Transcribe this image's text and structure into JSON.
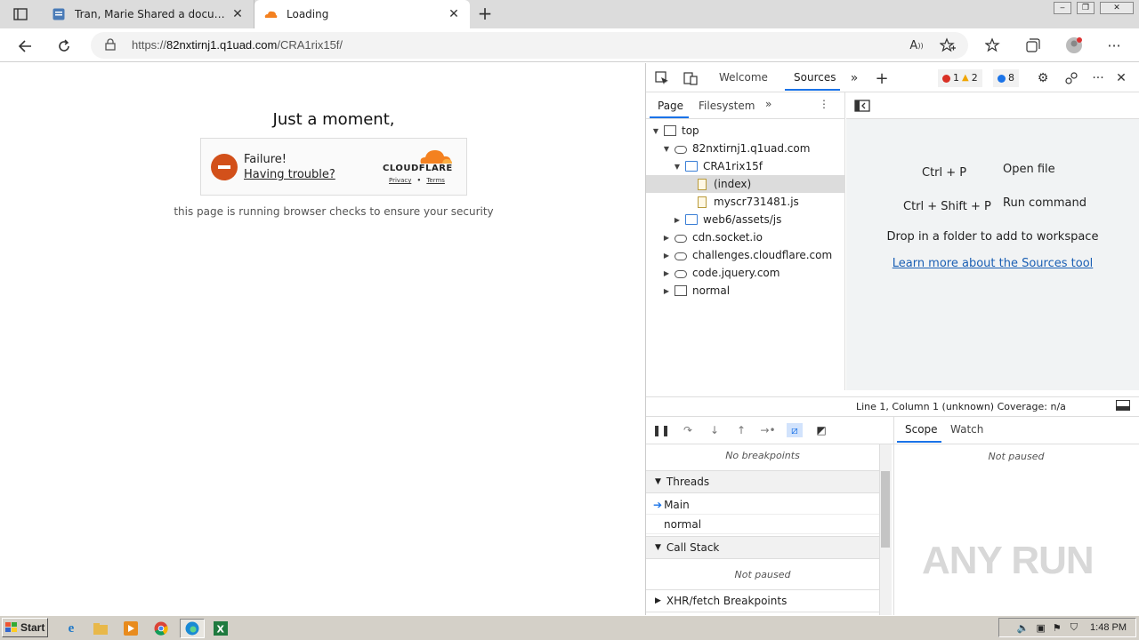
{
  "browser": {
    "tabs": [
      {
        "title": "Tran, Marie Shared a document w",
        "active": false
      },
      {
        "title": "Loading",
        "active": true
      }
    ],
    "address": {
      "scheme": "https://",
      "host": "82nxtirnj1.q1uad.com",
      "path": "/CRA1rix15f/"
    }
  },
  "page": {
    "heading": "Just a moment,",
    "challenge": {
      "status": "Failure!",
      "help_link": "Having trouble?",
      "brand": "CLOUDFLARE",
      "privacy": "Privacy",
      "separator": "•",
      "terms": "Terms"
    },
    "subtext": "this page is running browser checks to ensure your security"
  },
  "devtools": {
    "tabs": [
      "Welcome",
      "Sources"
    ],
    "active_tab": "Sources",
    "badges": {
      "errors": "1",
      "warnings": "2",
      "info": "8"
    },
    "navigator_tabs": [
      "Page",
      "Filesystem"
    ],
    "tree": [
      {
        "label": "top",
        "type": "frame",
        "depth": 0,
        "expanded": true
      },
      {
        "label": "82nxtirnj1.q1uad.com",
        "type": "cloud",
        "depth": 1,
        "expanded": true
      },
      {
        "label": "CRA1rix15f",
        "type": "folder",
        "depth": 2,
        "expanded": true
      },
      {
        "label": "(index)",
        "type": "file",
        "depth": 3,
        "selected": true
      },
      {
        "label": "myscr731481.js",
        "type": "file",
        "depth": 3
      },
      {
        "label": "web6/assets/js",
        "type": "folder",
        "depth": 2,
        "expanded": false
      },
      {
        "label": "cdn.socket.io",
        "type": "cloud",
        "depth": 1,
        "expanded": false
      },
      {
        "label": "challenges.cloudflare.com",
        "type": "cloud",
        "depth": 1,
        "expanded": false
      },
      {
        "label": "code.jquery.com",
        "type": "cloud",
        "depth": 1,
        "expanded": false
      },
      {
        "label": "normal",
        "type": "frame",
        "depth": 1,
        "expanded": false
      }
    ],
    "editor": {
      "shortcut1_keys": "Ctrl + P",
      "shortcut1_action": "Open file",
      "shortcut2_keys": "Ctrl + Shift + P",
      "shortcut2_action": "Run command",
      "drop_text": "Drop in a folder to add to workspace",
      "learn_link": "Learn more about the Sources tool"
    },
    "status": "Line 1, Column 1  (unknown)  Coverage: n/a",
    "debugger": {
      "no_breakpoints": "No breakpoints",
      "threads_label": "Threads",
      "threads": [
        "Main",
        "normal"
      ],
      "call_stack_label": "Call Stack",
      "call_stack_empty": "Not paused",
      "xhr_label": "XHR/fetch Breakpoints"
    },
    "scope_tabs": [
      "Scope",
      "Watch"
    ],
    "scope_empty": "Not paused"
  },
  "watermark": "ANY RUN",
  "taskbar": {
    "start": "Start",
    "clock": "1:48 PM"
  },
  "colors": {
    "accent": "#1a73e8",
    "cloudflare": "#f48120",
    "failure": "#d2501a"
  }
}
